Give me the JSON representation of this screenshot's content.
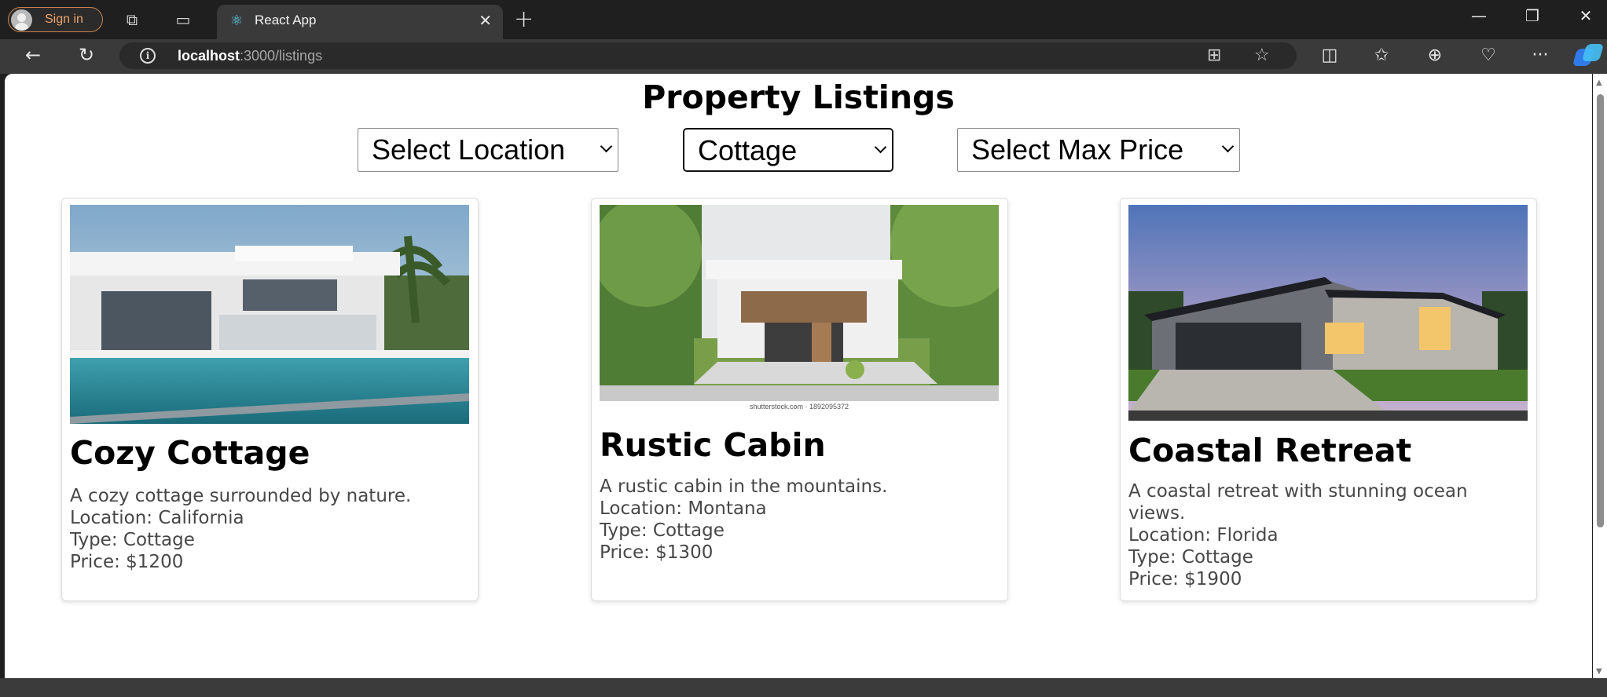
{
  "browser": {
    "signin_label": "Sign in",
    "tab_title": "React App",
    "url_host": "localhost",
    "url_path": ":3000/listings",
    "icons": [
      "workspaces-icon",
      "tab-actions-icon",
      "react-favicon-icon",
      "back-icon",
      "refresh-icon",
      "info-icon",
      "app-available-icon",
      "favorite-star-icon",
      "split-screen-icon",
      "favorites-icon",
      "collections-icon",
      "browser-essentials-icon",
      "more-icon",
      "copilot-icon"
    ]
  },
  "page": {
    "title": "Property Listings",
    "filters": {
      "location": "Select Location",
      "type": "Cottage",
      "max_price": "Select Max Price"
    },
    "listings": [
      {
        "name": "Cozy Cottage",
        "description": "A cozy cottage surrounded by nature.",
        "location": "Location: California",
        "type": "Type: Cottage",
        "price": "Price: $1200"
      },
      {
        "name": "Rustic Cabin",
        "description": "A rustic cabin in the mountains.",
        "location": "Location: Montana",
        "type": "Type: Cottage",
        "price": "Price: $1300",
        "image_watermark": "shutterstock.com · 1892095372"
      },
      {
        "name": "Coastal Retreat",
        "description": "A coastal retreat with stunning ocean views.",
        "location": "Location: Florida",
        "type": "Type: Cottage",
        "price": "Price: $1900"
      }
    ]
  },
  "colors": {
    "chrome_bg": "#1f1f1f",
    "addr_bg": "#3a3a3a",
    "signin_accent": "#f0a46a",
    "page_bg": "#ffffff",
    "card_text": "#474747"
  }
}
